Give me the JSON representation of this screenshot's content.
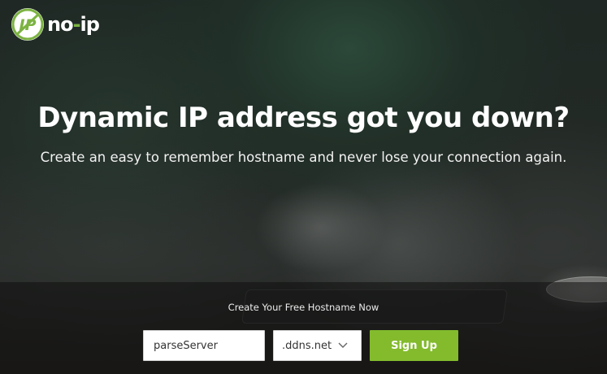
{
  "brand": {
    "logo_text": "no-ip",
    "logo_prefix": "no",
    "logo_dot": "-",
    "logo_suffix": "ip",
    "badge_letters": "IP",
    "accent_color": "#83bb2d"
  },
  "hero": {
    "headline": "Dynamic IP address got you down?",
    "subheadline": "Create an easy to remember hostname and never lose your connection again."
  },
  "signup_form": {
    "caption": "Create Your Free Hostname Now",
    "hostname_value": "parseServer",
    "domain_selected": ".ddns.net",
    "submit_label": "Sign Up",
    "icons": {
      "domain_dropdown": "chevron-down-icon"
    }
  }
}
